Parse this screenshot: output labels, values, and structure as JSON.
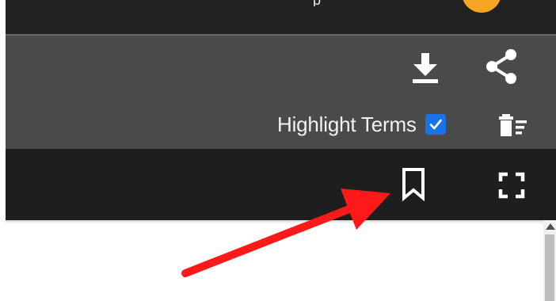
{
  "window": {
    "title_fragment": "p"
  },
  "toolbar": {
    "download_icon": "download-icon",
    "share_icon": "share-icon",
    "highlight_terms_label": "Highlight Terms",
    "highlight_terms_checked": true,
    "clear_highlights_icon": "clear-highlights-icon"
  },
  "viewer": {
    "bookmark_icon": "bookmark-icon",
    "fullscreen_icon": "fullscreen-icon"
  },
  "annotation": {
    "type": "arrow",
    "color": "#ff1a1a",
    "points_to": "bookmark-button"
  },
  "colors": {
    "topbar": "#222222",
    "toolbar": "#4a4a4a",
    "viewer_bar": "#1e1e1e",
    "checkbox_accent": "#1a73e8",
    "avatar": "#f5a623"
  }
}
